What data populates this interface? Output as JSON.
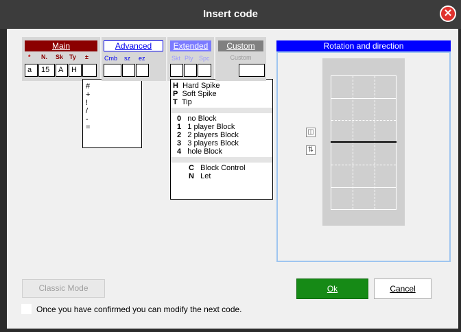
{
  "window": {
    "title": "Insert code",
    "close_glyph": "✕"
  },
  "main": {
    "header": "Main",
    "subheaders": [
      "*",
      "N.",
      "Sk",
      "Ty",
      "±"
    ],
    "fields": [
      "a",
      "15",
      "A",
      "H",
      ""
    ],
    "quality_options": [
      "#",
      "+",
      "!",
      "/",
      "-",
      "="
    ]
  },
  "advanced": {
    "header": "Advanced",
    "subheaders": [
      "Cmb",
      "sz",
      "ez"
    ]
  },
  "extended": {
    "header": "Extended",
    "subheaders": [
      "Skt",
      "Ply",
      "Spc"
    ],
    "options_type": [
      {
        "key": "H",
        "label": "Hard Spike"
      },
      {
        "key": "P",
        "label": "Soft Spike"
      },
      {
        "key": "T",
        "label": "Tip"
      }
    ],
    "options_block": [
      {
        "key": "0",
        "label": "no Block"
      },
      {
        "key": "1",
        "label": "1 player Block"
      },
      {
        "key": "2",
        "label": "2 players Block"
      },
      {
        "key": "3",
        "label": "3 players Block"
      },
      {
        "key": "4",
        "label": "hole Block"
      }
    ],
    "options_special": [
      {
        "key": "C",
        "label": "Block Control"
      },
      {
        "key": "N",
        "label": "Let"
      }
    ]
  },
  "custom": {
    "header": "Custom",
    "placeholder": "Custom"
  },
  "rotation": {
    "header": "Rotation and direction"
  },
  "buttons": {
    "classic_mode": "Classic Mode",
    "ok": "Ok",
    "cancel": "Cancel"
  },
  "confirm_text": "Once you have confirmed you can modify the next code.",
  "colors": {
    "main_header": "#8b0000",
    "advanced_header": "#0000ee",
    "extended_header": "#7b7bff",
    "custom_header": "#808080",
    "rotation_header": "#0000ff",
    "ok_button": "#168a16"
  }
}
